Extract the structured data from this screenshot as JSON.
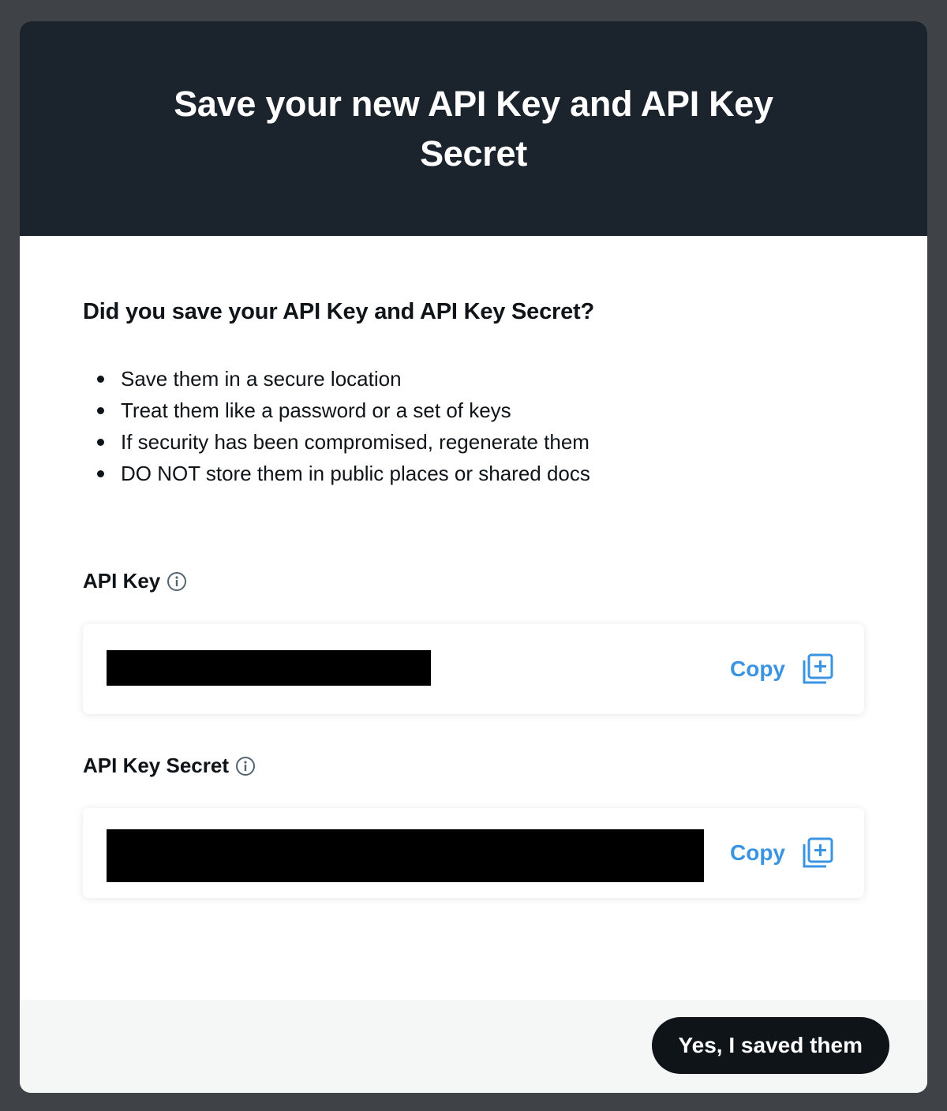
{
  "modal": {
    "title": "Save your new API Key and API Key Secret",
    "question": "Did you save your API Key and API Key Secret?",
    "tips": [
      "Save them in a secure location",
      "Treat them like a password or a set of keys",
      "If security has been compromised, regenerate them",
      "DO NOT store them in public places or shared docs"
    ],
    "api_key": {
      "label": "API Key",
      "info_icon": "info-circle-icon",
      "value_state": "redacted",
      "copy_label": "Copy",
      "copy_icon": "copy-plus-icon"
    },
    "api_key_secret": {
      "label": "API Key Secret",
      "info_icon": "info-circle-icon",
      "value_state": "redacted",
      "copy_label": "Copy",
      "copy_icon": "copy-plus-icon"
    },
    "footer": {
      "confirm_label": "Yes, I saved them"
    }
  },
  "colors": {
    "page_background": "#3f4247",
    "header_background": "#1b232d",
    "accent_link": "#3b94e1",
    "primary_button": "#0f1419",
    "footer_background": "#f5f7f7"
  }
}
